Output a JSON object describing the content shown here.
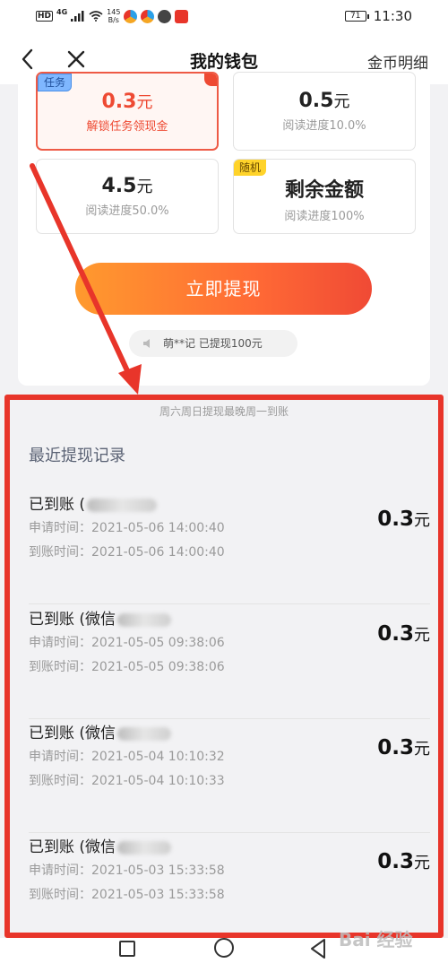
{
  "status_bar": {
    "hd": "HD",
    "network": "4G",
    "speed_value": "145",
    "speed_unit": "B/s",
    "battery": "71",
    "time": "11:30"
  },
  "nav": {
    "title": "我的钱包",
    "right_link": "金币明细"
  },
  "options": [
    {
      "tag": "任务",
      "amount": "0.3",
      "unit": "元",
      "subtitle": "解锁任务领现金",
      "selected": true
    },
    {
      "tag": "",
      "amount": "0.5",
      "unit": "元",
      "subtitle": "阅读进度10.0%",
      "selected": false
    },
    {
      "tag": "",
      "amount": "4.5",
      "unit": "元",
      "subtitle": "阅读进度50.0%",
      "selected": false
    },
    {
      "tag": "随机",
      "amount": "剩余金额",
      "unit": "",
      "subtitle": "阅读进度100%",
      "selected": false
    }
  ],
  "withdraw_button": "立即提现",
  "notice": "萌**记 已提现100元",
  "tip": "周六周日提现最晚周一到账",
  "records_title": "最近提现记录",
  "records": [
    {
      "status": "已到账 (",
      "apply": "申请时间：2021-05-06 14:00:40",
      "arrive": "到账时间：2021-05-06 14:00:40",
      "amount": "0.3",
      "unit": "元"
    },
    {
      "status": "已到账 (微信",
      "apply": "申请时间：2021-05-05 09:38:06",
      "arrive": "到账时间：2021-05-05 09:38:06",
      "amount": "0.3",
      "unit": "元"
    },
    {
      "status": "已到账 (微信",
      "apply": "申请时间：2021-05-04 10:10:32",
      "arrive": "到账时间：2021-05-04 10:10:33",
      "amount": "0.3",
      "unit": "元"
    },
    {
      "status": "已到账 (微信",
      "apply": "申请时间：2021-05-03 15:33:58",
      "arrive": "到账时间：2021-05-03 15:33:58",
      "amount": "0.3",
      "unit": "元"
    }
  ],
  "watermark": "Bai 经验",
  "colors": {
    "accent_red": "#ee4a33",
    "annotation_red": "#e8352a",
    "button_gradient_start": "#ff9a2e",
    "button_gradient_end": "#f04a35",
    "tag_blue": "#7fb7ff",
    "tag_yellow": "#ffd32a"
  }
}
